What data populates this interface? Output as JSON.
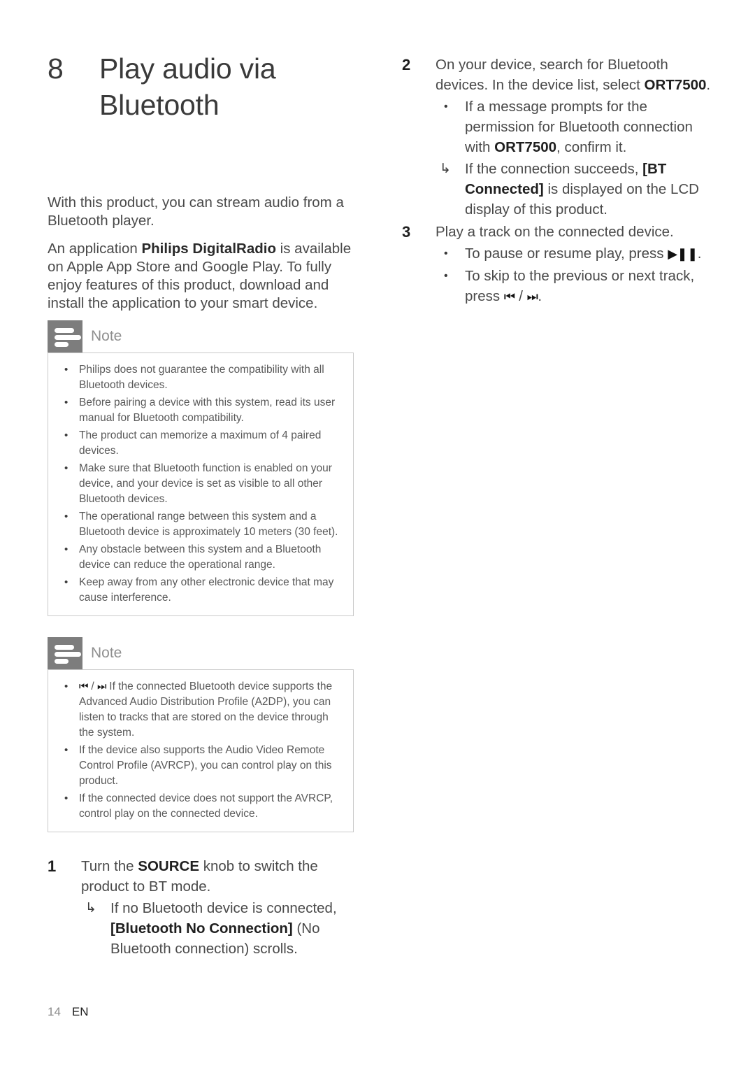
{
  "chapter": {
    "number": "8",
    "title_line1": "Play audio via",
    "title_line2": "Bluetooth"
  },
  "intro": {
    "paragraph1": "With this product, you can stream audio from a Bluetooth player.",
    "paragraph2_before": "An application ",
    "paragraph2_bold": "Philips DigitalRadio",
    "paragraph2_after": " is available on Apple App Store and Google Play. To fully enjoy features of this product, download and install the application to your smart device."
  },
  "notes": [
    {
      "title": "Note",
      "icon": "note-lines-icon",
      "items": [
        "Philips does not guarantee the compatibility with all Bluetooth devices.",
        "Before pairing a device with this system, read its user manual for Bluetooth compatibility.",
        "The product can memorize a maximum of 4 paired devices.",
        "Make sure that Bluetooth function is enabled on your device, and your device is set as visible to all other Bluetooth devices.",
        "The operational range between this system and a Bluetooth device is approximately 10 meters (30 feet).",
        "Any obstacle between this system and a Bluetooth device can reduce the operational range.",
        "Keep away from any other electronic device that may cause interference."
      ]
    },
    {
      "title": "Note",
      "icon": "note-lines-icon",
      "items": [
        {
          "glyph_prev": "⏮",
          "glyph_next": "⏭",
          "separator": " / ",
          "text": " If the connected Bluetooth device supports the Advanced Audio Distribution Profile (A2DP), you can listen to tracks that are stored on the device through the system."
        },
        "If the device also supports the Audio Video Remote Control Profile (AVRCP), you can control play on this product.",
        "If the connected device does not support the AVRCP, control play on the connected device."
      ]
    }
  ],
  "steps": [
    {
      "number": "1",
      "text_before": "Turn the ",
      "text_bold": "SOURCE",
      "text_after": " knob to switch the product to BT mode.",
      "substeps": [
        {
          "marker": "↳",
          "marker_type": "arrow",
          "before": "If no Bluetooth device is connected, ",
          "bold": "[Bluetooth No Connection]",
          "after": " (No Bluetooth connection) scrolls."
        }
      ]
    },
    {
      "number": "2",
      "text_before": "On your device, search for Bluetooth devices. In the device list, select ",
      "text_bold": "ORT7500",
      "text_after": ".",
      "substeps": [
        {
          "marker": "•",
          "marker_type": "bullet",
          "before": "If a message prompts for the permission for Bluetooth connection with ",
          "bold": "ORT7500",
          "after": ", confirm it."
        },
        {
          "marker": "↳",
          "marker_type": "arrow",
          "before": "If the connection succeeds, ",
          "bold": "[BT Connected]",
          "after": " is displayed on the LCD display of this product."
        }
      ]
    },
    {
      "number": "3",
      "text_before": "Play a track on the connected device.",
      "text_bold": "",
      "text_after": "",
      "substeps": [
        {
          "marker": "•",
          "marker_type": "bullet",
          "before": "To pause or resume play, press ",
          "glyph": "▶❚❚",
          "after": "."
        },
        {
          "marker": "•",
          "marker_type": "bullet",
          "before": "To skip to the previous or next track, press ",
          "glyph_prev": "⏮",
          "glyph_sep": " / ",
          "glyph_next": "⏭",
          "after": "."
        }
      ]
    }
  ],
  "footer": {
    "page_number": "14",
    "language": "EN"
  },
  "colors": {
    "note_icon_bg": "#7d7d7d",
    "note_border": "#c9c9c9",
    "body_text": "#4a4a4a",
    "heading_text": "#3a3a3a"
  }
}
